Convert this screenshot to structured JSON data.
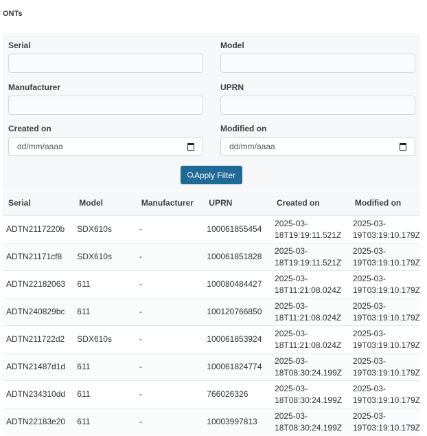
{
  "page": {
    "title": "ONTs"
  },
  "filters": {
    "serial_label": "Serial",
    "serial_value": "",
    "model_label": "Model",
    "model_value": "",
    "manufacturer_label": "Manufacturer",
    "manufacturer_value": "",
    "uprn_label": "UPRN",
    "uprn_value": "",
    "created_label": "Created on",
    "created_placeholder": "dd/mm/aaaa",
    "modified_label": "Modified on",
    "modified_placeholder": "dd/mm/aaaa",
    "apply_label": "Apply Filter"
  },
  "table": {
    "headers": [
      "Serial",
      "Model",
      "Manufacturer",
      "UPRN",
      "Created on",
      "Modified on"
    ],
    "rows": [
      {
        "serial": "ADTN2117220b",
        "model": "SDX610s",
        "manufacturer": "-",
        "uprn": "100061855454",
        "created_date": "2025-03-",
        "created_time": "18T19:19:11.521Z",
        "modified_date": "2025-03-",
        "modified_time": "19T03:19:10.179Z"
      },
      {
        "serial": "ADTN21171cf8",
        "model": "SDX610s",
        "manufacturer": "-",
        "uprn": "100061851828",
        "created_date": "2025-03-",
        "created_time": "18T19:19:11.521Z",
        "modified_date": "2025-03-",
        "modified_time": "19T03:19:10.179Z"
      },
      {
        "serial": "ADTN22182063",
        "model": "611",
        "manufacturer": "-",
        "uprn": "100080484427",
        "created_date": "2025-03-",
        "created_time": "18T11:21:08.024Z",
        "modified_date": "2025-03-",
        "modified_time": "19T03:19:10.179Z"
      },
      {
        "serial": "ADTN240829bc",
        "model": "611",
        "manufacturer": "-",
        "uprn": "100120766850",
        "created_date": "2025-03-",
        "created_time": "18T11:21:08.024Z",
        "modified_date": "2025-03-",
        "modified_time": "19T03:19:10.179Z"
      },
      {
        "serial": "ADTN211722d2",
        "model": "SDX610s",
        "manufacturer": "-",
        "uprn": "100061853924",
        "created_date": "2025-03-",
        "created_time": "18T11:21:08.024Z",
        "modified_date": "2025-03-",
        "modified_time": "19T03:19:10.179Z"
      },
      {
        "serial": "ADTN21487d1d",
        "model": "611",
        "manufacturer": "-",
        "uprn": "100061824774",
        "created_date": "2025-03-",
        "created_time": "18T08:30:24.199Z",
        "modified_date": "2025-03-",
        "modified_time": "19T03:19:10.179Z"
      },
      {
        "serial": "ADTN234310dd",
        "model": "611",
        "manufacturer": "-",
        "uprn": "766026326",
        "created_date": "2025-03-",
        "created_time": "18T08:30:24.199Z",
        "modified_date": "2025-03-",
        "modified_time": "19T03:19:10.179Z"
      },
      {
        "serial": "ADTN22183e20",
        "model": "611",
        "manufacturer": "-",
        "uprn": "10003997813",
        "created_date": "2025-03-",
        "created_time": "18T08:30:24.199Z",
        "modified_date": "2025-03-",
        "modified_time": "19T03:19:10.179Z"
      }
    ]
  }
}
